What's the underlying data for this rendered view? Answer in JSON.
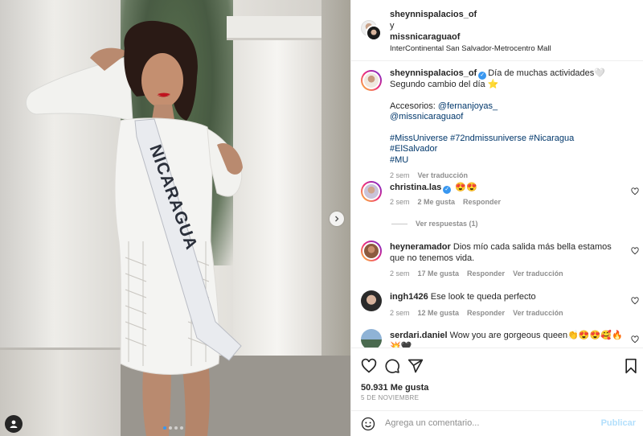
{
  "post": {
    "authors": {
      "primary": "sheynnispalacios_of",
      "joiner": "y",
      "secondary": "missnicaraguaof"
    },
    "location": "InterContinental San Salvador-Metrocentro Mall",
    "photo": {
      "sash_text": "NICARAGUA",
      "carousel_count": 4,
      "carousel_active": 1
    }
  },
  "caption": {
    "username": "sheynnispalacios_of",
    "line1": "Día de muchas actividades🤍",
    "line2": "Segundo cambio del día ⭐",
    "accessories_label": "Accesorios:",
    "mention1": "@fernanjoyas_",
    "mention2": "@missnicaraguaof",
    "hashtags": "#MissUniverse #72ndmissuniverse #Nicaragua #ElSalvador",
    "hashtags2": "#MU",
    "time": "2 sem",
    "translate": "Ver traducción"
  },
  "comments": [
    {
      "username": "christina.las",
      "text": "😍😍",
      "time": "2 sem",
      "likes": "2 Me gusta",
      "reply": "Responder",
      "view_replies": "Ver respuestas (1)"
    },
    {
      "username": "heyneramador",
      "text": "Dios mío cada salida más bella estamos que no tenemos vida.",
      "time": "2 sem",
      "likes": "17 Me gusta",
      "reply": "Responder",
      "translate": "Ver traducción"
    },
    {
      "username": "ingh1426",
      "text": "Ese look te queda perfecto",
      "time": "2 sem",
      "likes": "12 Me gusta",
      "reply": "Responder",
      "translate": "Ver traducción"
    },
    {
      "username": "serdari.daniel",
      "text": "Wow you are gorgeous queen👏😍😍🥰🔥💥🖤",
      "text2": "🖤🤍"
    }
  ],
  "actions": {
    "likes": "50.931 Me gusta",
    "date": "5 DE NOVIEMBRE",
    "icons": [
      "heart-icon",
      "comment-icon",
      "share-icon",
      "bookmark-icon"
    ]
  },
  "composer": {
    "placeholder": "Agrega un comentario...",
    "post": "Publicar"
  },
  "colors": {
    "link": "#00376b",
    "accent": "#3897f0",
    "muted": "#8e8e8e",
    "dress": "#f4f4f2",
    "sash": "#e9ebef"
  }
}
